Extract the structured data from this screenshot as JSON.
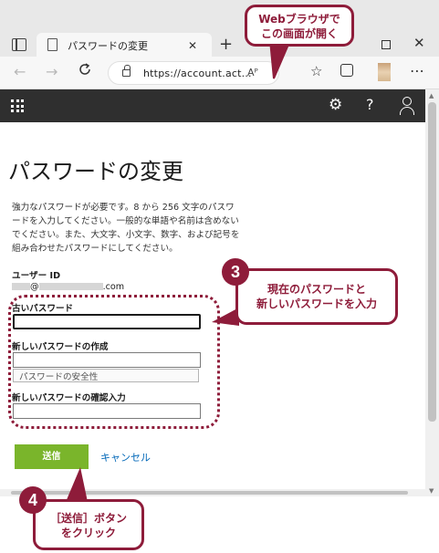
{
  "browser": {
    "tab_title": "パスワードの変更",
    "tab_close": "✕",
    "new_tab": "+",
    "url": "https://account.act...",
    "read_aloud": "Aᴾ",
    "nav_back": "←",
    "nav_forward": "→",
    "reload": "C",
    "favorites": "☆",
    "menu": "⋯",
    "window_close": "✕"
  },
  "appbar": {
    "settings": "⚙",
    "help": "?"
  },
  "page": {
    "heading": "パスワードの変更",
    "description": "強力なパスワードが必要です。8 から 256 文字のパスワードを入力してください。一般的な単語や名前は含めないでください。また、大文字、小文字、数字、および記号を組み合わせたパスワードにしてください。",
    "user_id_label": "ユーザー ID",
    "user_id_at": "@",
    "user_id_domain": ".com",
    "old_password_label": "古いパスワード",
    "new_password_label": "新しいパスワードの作成",
    "strength_label": "パスワードの安全性",
    "confirm_password_label": "新しいパスワードの確認入力",
    "submit_label": "送信",
    "cancel_label": "キャンセル"
  },
  "annotations": {
    "callout_browser": [
      "Webブラウザで",
      "この画面が開く"
    ],
    "callout_3": [
      "現在のパスワードと",
      "新しいパスワードを入力"
    ],
    "callout_4": [
      "［送信］ボタン",
      "をクリック"
    ],
    "badge_3": "3",
    "badge_4": "4",
    "accent_color": "#8e1c3a"
  },
  "colors": {
    "appbar": "#2f2f2f",
    "submit": "#7ab52b",
    "link": "#0067b8"
  }
}
